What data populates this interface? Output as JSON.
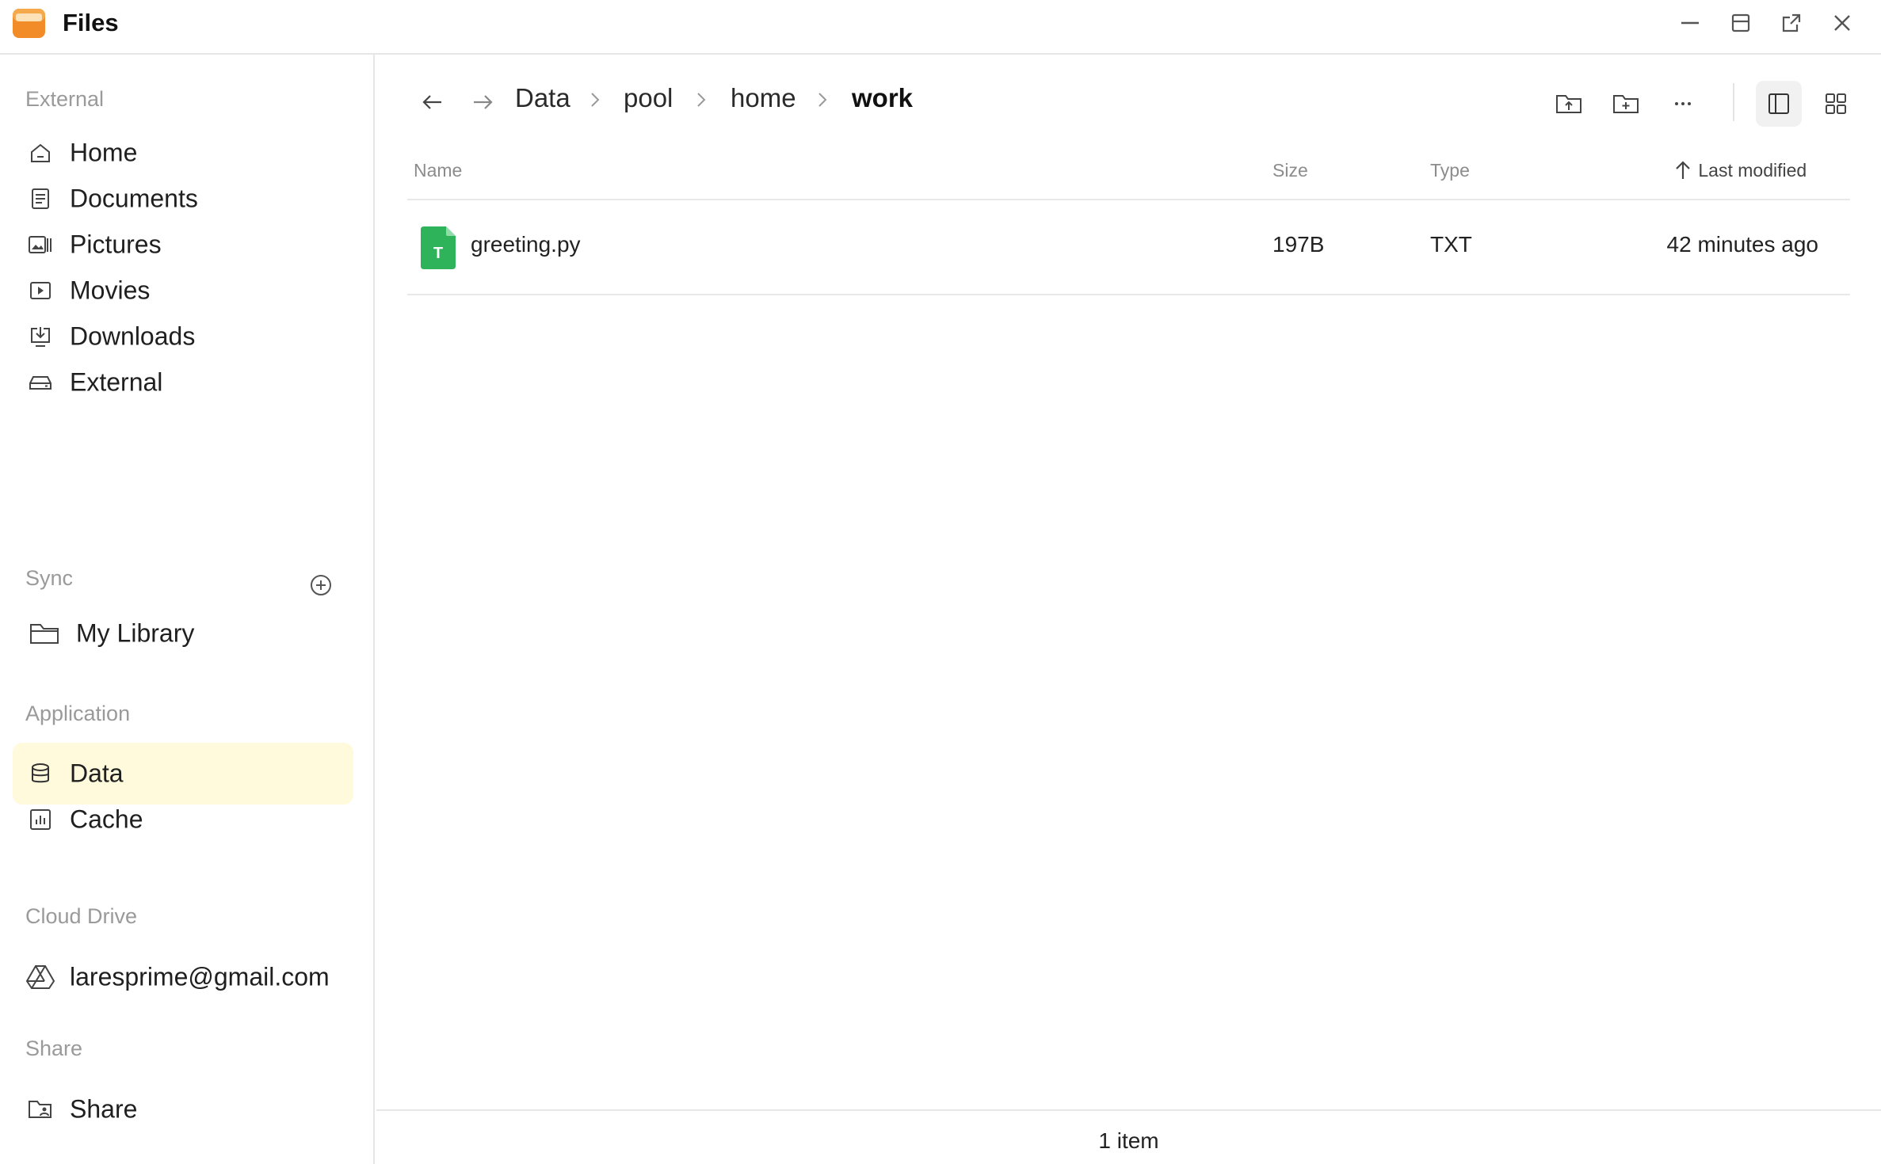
{
  "window": {
    "title": "Files",
    "logo_color": "#f28c28"
  },
  "sidebar": {
    "sections": {
      "external": "External",
      "sync": "Sync",
      "application": "Application",
      "cloud_drive": "Cloud Drive",
      "share": "Share"
    },
    "external_items": [
      {
        "label": "Home",
        "icon": "home-icon"
      },
      {
        "label": "Documents",
        "icon": "document-icon"
      },
      {
        "label": "Pictures",
        "icon": "pictures-icon"
      },
      {
        "label": "Movies",
        "icon": "movie-icon"
      },
      {
        "label": "Downloads",
        "icon": "download-icon"
      },
      {
        "label": "External",
        "icon": "drive-icon"
      }
    ],
    "sync_items": [
      {
        "label": "My Library",
        "icon": "folder-icon"
      }
    ],
    "application_items": [
      {
        "label": "Data",
        "icon": "database-icon",
        "active": true
      },
      {
        "label": "Cache",
        "icon": "chart-icon"
      }
    ],
    "cloud_items": [
      {
        "label": "laresprime@gmail.com",
        "icon": "google-drive-icon"
      }
    ],
    "share_items": [
      {
        "label": "Share",
        "icon": "share-folder-icon"
      }
    ],
    "active_color": "#fffadc"
  },
  "breadcrumb": [
    "Data",
    "pool",
    "home",
    "work"
  ],
  "columns": {
    "name": "Name",
    "size": "Size",
    "type": "Type",
    "modified": "Last modified"
  },
  "files": [
    {
      "name": "greeting.py",
      "size": "197B",
      "type": "TXT",
      "modified": "42 minutes ago",
      "icon_letter": "T",
      "icon_color": "#2eb35a"
    }
  ],
  "status": {
    "count": "1 item"
  }
}
